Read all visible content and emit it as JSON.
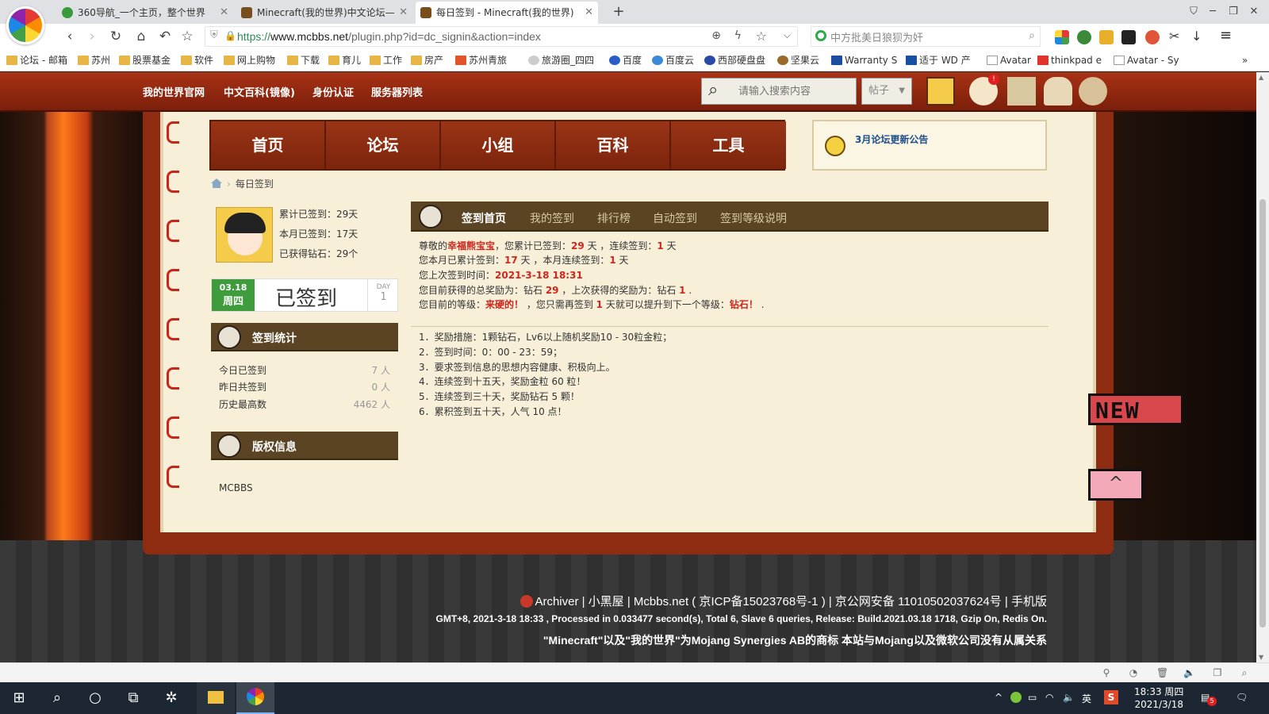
{
  "browser": {
    "tabs": [
      {
        "title": "360导航_一个主页，整个世界",
        "icon_color": "#3a9a3a"
      },
      {
        "title": "Minecraft(我的世界)中文论坛—",
        "icon_color": "#7a4d1c"
      },
      {
        "title": "每日签到 - Minecraft(我的世界)",
        "icon_color": "#7a4d1c"
      }
    ],
    "active_tab": 2,
    "url_scheme": "https://",
    "url_host": "www.mcbbs.net",
    "url_path": "/plugin.php?id=dc_signin&action=index",
    "search_text": "中方批美日狼狈为奸",
    "bookmarks": [
      "论坛 - 邮箱",
      "苏州",
      "股票基金",
      "软件",
      "网上购物",
      "下载",
      "育儿",
      "工作",
      "房产",
      "苏州青旅",
      "旅游圈_四四",
      "百度",
      "百度云",
      "西部硬盘盘",
      "坚果云",
      "Warranty S",
      "适于 WD 产",
      "Avatar",
      "thinkpad e",
      "Avatar - Sy"
    ]
  },
  "site": {
    "header_links": [
      "我的世界官网",
      "中文百科(镜像)",
      "身份认证",
      "服务器列表"
    ],
    "search_placeholder": "请输入搜索内容",
    "search_type": "帖子",
    "nav": [
      "首页",
      "论坛",
      "小组",
      "百科",
      "工具"
    ],
    "notice": "3月论坛更新公告",
    "breadcrumb": "每日签到"
  },
  "user": {
    "stats": [
      "累计已签到：29天",
      "本月已签到：17天",
      "已获得钻石：29个"
    ]
  },
  "signin": {
    "date": "03.18",
    "weekday": "周四",
    "status": "已签到",
    "day_label": "DAY",
    "day_value": "1"
  },
  "panels": {
    "stats_title": "签到统计",
    "stats": [
      {
        "label": "今日已签到",
        "value": "7 人"
      },
      {
        "label": "昨日共签到",
        "value": "0 人"
      },
      {
        "label": "历史最高数",
        "value": "4462 人"
      }
    ],
    "copyright_title": "版权信息",
    "copyright_text": "MCBBS"
  },
  "signin_tabs": [
    "签到首页",
    "我的签到",
    "排行榜",
    "自动签到",
    "签到等级说明"
  ],
  "info": {
    "l1_a": "尊敬的",
    "l1_user": "幸福熊宝宝",
    "l1_b": "，您累计已签到：",
    "l1_total": "29",
    "l1_c": " 天 ，连续签到：",
    "l1_cont": "1",
    "l1_d": " 天",
    "l2_a": "您本月已累计签到：",
    "l2_month": "17",
    "l2_b": " 天 ，本月连续签到：",
    "l2_mcont": "1",
    "l2_c": " 天",
    "l3_a": "您上次签到时间：",
    "l3_time": "2021-3-18 18:31",
    "l4_a": "您目前获得的总奖励为：钻石 ",
    "l4_total": "29",
    "l4_b": " ，上次获得的奖励为：钻石 ",
    "l4_last": "1",
    "l4_c": " .",
    "l5_a": "您目前的等级：",
    "l5_level": "来硬的！",
    "l5_b": " ，您只需再签到 ",
    "l5_need": "1",
    "l5_c": " 天就可以提升到下一个等级：",
    "l5_next": "钻石！",
    "l5_d": " ."
  },
  "rules": [
    "1．奖励措施：1颗钻石，Lv6以上随机奖励10 - 30粒金粒；",
    "2．签到时间：0：00 - 23：59；",
    "3．要求签到信息的思想内容健康、积极向上。",
    "4．连续签到十五天，奖励金粒 60 粒！",
    "5．连续签到三十天，奖励钻石 5 颗！",
    "6．累积签到五十天，人气 10 点！"
  ],
  "flags": {
    "new": "NEW",
    "top": "^"
  },
  "footer": {
    "line1": "Archiver | 小黑屋 | Mcbbs.net ( 京ICP备15023768号-1 ) | 京公网安备 11010502037624号 | 手机版",
    "line2": "GMT+8, 2021-3-18 18:33 , Processed in 0.033477 second(s), Total 6, Slave 6 queries, Release: Build.2021.03.18 1718, Gzip On, Redis On.",
    "line3": "\"Minecraft\"以及\"我的世界\"为Mojang Synergies AB的商标 本站与Mojang以及微软公司没有从属关系"
  },
  "taskbar": {
    "ime": "英",
    "time": "18:33 周四",
    "date": "2021/3/18",
    "notif_count": "5"
  }
}
